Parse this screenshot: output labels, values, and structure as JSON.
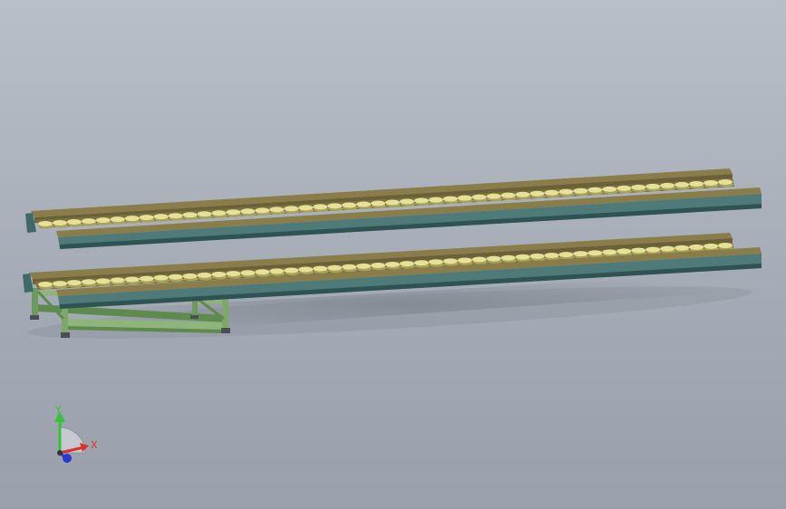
{
  "viewport": {
    "background_top": "#b9bfc7",
    "background_bottom": "#99a0ab"
  },
  "model": {
    "conveyors": [
      {
        "name": "upper-roller-conveyor",
        "roller_count": 48,
        "has_stand": false
      },
      {
        "name": "lower-roller-conveyor",
        "roller_count": 48,
        "has_stand": true
      }
    ],
    "colors": {
      "rail_top": "#8a7d4a",
      "rail_side": "#4e7a7a",
      "rail_dark": "#2f5252",
      "roller": "#e6e196",
      "roller_shadow": "#a8a25a",
      "frame": "#8fb57a",
      "frame_dark": "#5f8a4e",
      "foot": "#4b4f55"
    }
  },
  "triad": {
    "x_label": "X",
    "y_label": "Y",
    "x_color": "#e0302a",
    "y_color": "#38c238",
    "z_color": "#2a3ad0"
  }
}
